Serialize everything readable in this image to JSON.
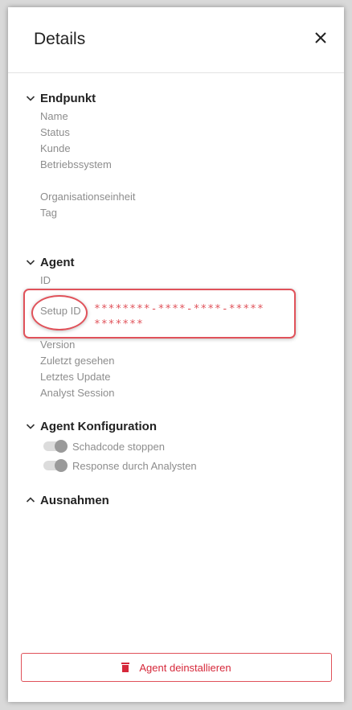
{
  "header": {
    "title": "Details"
  },
  "sections": {
    "endpoint": {
      "title": "Endpunkt",
      "fields": [
        "Name",
        "Status",
        "Kunde",
        "Betriebssystem",
        "Organisationseinheit",
        "Tag"
      ]
    },
    "agent": {
      "title": "Agent",
      "id_label": "ID",
      "setup_id_label": "Setup ID",
      "setup_id_value": "********-****-****-************",
      "fields": [
        "Version",
        "Zuletzt gesehen",
        "Letztes Update",
        "Analyst Session"
      ]
    },
    "agent_config": {
      "title": "Agent Konfiguration",
      "toggles": [
        "Schadcode stoppen",
        "Response durch Analysten"
      ]
    },
    "exceptions": {
      "title": "Ausnahmen"
    }
  },
  "footer": {
    "uninstall_label": "Agent deinstallieren"
  },
  "colors": {
    "accent_red": "#e0525a",
    "danger_text": "#d6283a",
    "muted_text": "#8d8d8d"
  },
  "icons": {
    "close": "close-icon",
    "chevron_down": "chevron-down-icon",
    "chevron_up": "chevron-up-icon",
    "trash": "trash-icon"
  }
}
